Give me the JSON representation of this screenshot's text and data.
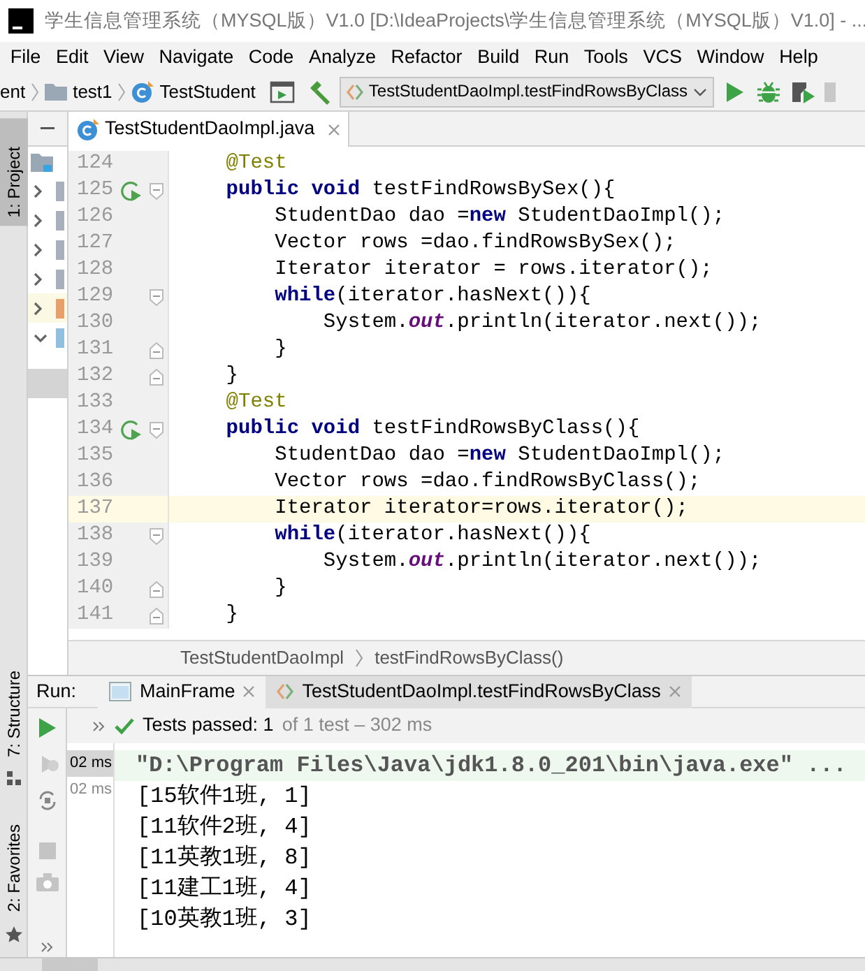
{
  "window": {
    "title": "学生信息管理系统（MYSQL版）V1.0 [D:\\IdeaProjects\\学生信息管理系统（MYSQL版）V1.0] - ..."
  },
  "menu": [
    "File",
    "Edit",
    "View",
    "Navigate",
    "Code",
    "Analyze",
    "Refactor",
    "Build",
    "Run",
    "Tools",
    "VCS",
    "Window",
    "Help"
  ],
  "nav_bar": {
    "breadcrumbs": [
      {
        "label": "ent",
        "kind": "plain"
      },
      {
        "label": "test1",
        "kind": "folder"
      },
      {
        "label": "TestStudent",
        "kind": "class"
      }
    ],
    "run_config": "TestStudentDaoImpl.testFindRowsByClass"
  },
  "tool_strip": [
    {
      "label": "1: Project",
      "selected": true,
      "kind": "top"
    },
    {
      "label": "7: Structure",
      "selected": false,
      "kind": "bottom"
    },
    {
      "label": "2: Favorites",
      "selected": false,
      "kind": "bottom"
    }
  ],
  "project_tree": [
    {
      "expanded": false,
      "selected": false,
      "color": "#a9b0bb"
    },
    {
      "expanded": false,
      "selected": false,
      "color": "#a9b0bb"
    },
    {
      "expanded": false,
      "selected": false,
      "color": "#a9b0bb"
    },
    {
      "expanded": false,
      "selected": false,
      "color": "#a9b0bb"
    },
    {
      "expanded": false,
      "selected": true,
      "color": "#e8a06a"
    },
    {
      "expanded": true,
      "selected": false,
      "color": "#8fc0e0"
    }
  ],
  "editor": {
    "tabs": [
      {
        "label": "TestStudentDaoImpl.java",
        "selected": true
      }
    ],
    "lines": [
      {
        "number": "124",
        "current": false,
        "run_marker": false,
        "fold_open": false,
        "fold_close": false,
        "tokens": [
          {
            "kind": "annotation",
            "text": "    @Test"
          }
        ]
      },
      {
        "number": "125",
        "current": false,
        "run_marker": true,
        "fold_open": true,
        "fold_close": false,
        "tokens": [
          {
            "kind": "keyword",
            "text": "    public void"
          },
          {
            "kind": "plain",
            "text": " testFindRowsBySex(){"
          }
        ]
      },
      {
        "number": "126",
        "current": false,
        "run_marker": false,
        "fold_open": false,
        "fold_close": false,
        "tokens": [
          {
            "kind": "plain",
            "text": "        StudentDao dao ="
          },
          {
            "kind": "keyword",
            "text": "new"
          },
          {
            "kind": "plain",
            "text": " StudentDaoImpl();"
          }
        ]
      },
      {
        "number": "127",
        "current": false,
        "run_marker": false,
        "fold_open": false,
        "fold_close": false,
        "tokens": [
          {
            "kind": "plain",
            "text": "        Vector rows =dao.findRowsBySex();"
          }
        ]
      },
      {
        "number": "128",
        "current": false,
        "run_marker": false,
        "fold_open": false,
        "fold_close": false,
        "tokens": [
          {
            "kind": "plain",
            "text": "        Iterator iterator = rows.iterator();"
          }
        ]
      },
      {
        "number": "129",
        "current": false,
        "run_marker": false,
        "fold_open": true,
        "fold_close": false,
        "tokens": [
          {
            "kind": "keyword",
            "text": "        while"
          },
          {
            "kind": "plain",
            "text": "(iterator.hasNext()){"
          }
        ]
      },
      {
        "number": "130",
        "current": false,
        "run_marker": false,
        "fold_open": false,
        "fold_close": false,
        "tokens": [
          {
            "kind": "plain",
            "text": "            System."
          },
          {
            "kind": "field",
            "text": "out"
          },
          {
            "kind": "plain",
            "text": ".println(iterator.next());"
          }
        ]
      },
      {
        "number": "131",
        "current": false,
        "run_marker": false,
        "fold_open": false,
        "fold_close": true,
        "tokens": [
          {
            "kind": "plain",
            "text": "        }"
          }
        ]
      },
      {
        "number": "132",
        "current": false,
        "run_marker": false,
        "fold_open": false,
        "fold_close": true,
        "tokens": [
          {
            "kind": "plain",
            "text": "    }"
          }
        ]
      },
      {
        "number": "133",
        "current": false,
        "run_marker": false,
        "fold_open": false,
        "fold_close": false,
        "tokens": [
          {
            "kind": "annotation",
            "text": "    @Test"
          }
        ]
      },
      {
        "number": "134",
        "current": false,
        "run_marker": true,
        "fold_open": true,
        "fold_close": false,
        "tokens": [
          {
            "kind": "keyword",
            "text": "    public void"
          },
          {
            "kind": "plain",
            "text": " testFindRowsByClass(){"
          }
        ]
      },
      {
        "number": "135",
        "current": false,
        "run_marker": false,
        "fold_open": false,
        "fold_close": false,
        "tokens": [
          {
            "kind": "plain",
            "text": "        StudentDao dao ="
          },
          {
            "kind": "keyword",
            "text": "new"
          },
          {
            "kind": "plain",
            "text": " StudentDaoImpl();"
          }
        ]
      },
      {
        "number": "136",
        "current": false,
        "run_marker": false,
        "fold_open": false,
        "fold_close": false,
        "tokens": [
          {
            "kind": "plain",
            "text": "        Vector rows =dao.findRowsByClass();"
          }
        ]
      },
      {
        "number": "137",
        "current": true,
        "run_marker": false,
        "fold_open": false,
        "fold_close": false,
        "tokens": [
          {
            "kind": "plain",
            "text": "        Iterator iterator=rows.iterator();"
          }
        ]
      },
      {
        "number": "138",
        "current": false,
        "run_marker": false,
        "fold_open": true,
        "fold_close": false,
        "tokens": [
          {
            "kind": "keyword",
            "text": "        while"
          },
          {
            "kind": "plain",
            "text": "(iterator.hasNext()){"
          }
        ]
      },
      {
        "number": "139",
        "current": false,
        "run_marker": false,
        "fold_open": false,
        "fold_close": false,
        "tokens": [
          {
            "kind": "plain",
            "text": "            System."
          },
          {
            "kind": "field",
            "text": "out"
          },
          {
            "kind": "plain",
            "text": ".println(iterator.next());"
          }
        ]
      },
      {
        "number": "140",
        "current": false,
        "run_marker": false,
        "fold_open": false,
        "fold_close": true,
        "tokens": [
          {
            "kind": "plain",
            "text": "        }"
          }
        ]
      },
      {
        "number": "141",
        "current": false,
        "run_marker": false,
        "fold_open": false,
        "fold_close": true,
        "tokens": [
          {
            "kind": "plain",
            "text": "    }"
          }
        ]
      }
    ]
  },
  "breadcrumbs": [
    "TestStudentDaoImpl",
    "testFindRowsByClass()"
  ],
  "run_panel": {
    "label": "Run:",
    "tabs": [
      {
        "label": "MainFrame",
        "selected": false,
        "kind": "app"
      },
      {
        "label": "TestStudentDaoImpl.testFindRowsByClass",
        "selected": true,
        "kind": "test"
      }
    ],
    "status": {
      "passed": "Tests passed: 1",
      "detail": "of 1 test – 302 ms"
    },
    "test_tree": [
      {
        "text": "02 ms",
        "selected": true
      },
      {
        "text": "02 ms",
        "selected": false
      }
    ],
    "console": [
      {
        "kind": "command",
        "text": "\"D:\\Program Files\\Java\\jdk1.8.0_201\\bin\\java.exe\" ..."
      },
      {
        "kind": "output",
        "text": "[15软件1班, 1]"
      },
      {
        "kind": "output",
        "text": "[11软件2班, 4]"
      },
      {
        "kind": "output",
        "text": "[11英教1班, 8]"
      },
      {
        "kind": "output",
        "text": "[11建工1班, 4]"
      },
      {
        "kind": "output",
        "text": "[10英教1班, 3]"
      }
    ]
  }
}
